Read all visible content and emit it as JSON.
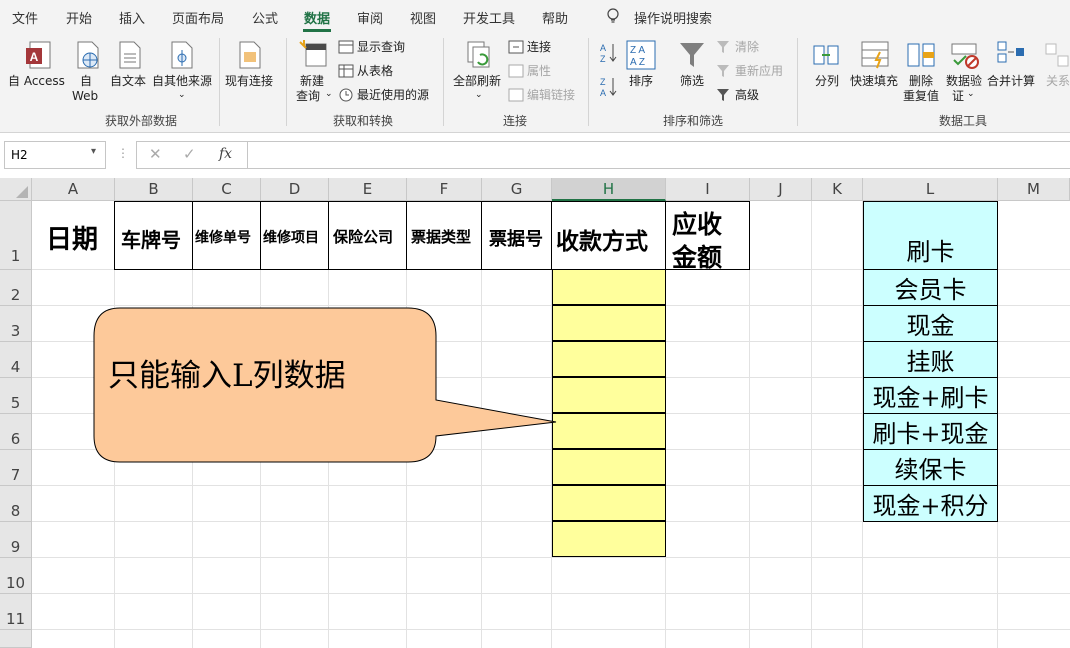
{
  "menu": {
    "items": [
      "文件",
      "开始",
      "插入",
      "页面布局",
      "公式",
      "数据",
      "审阅",
      "视图",
      "开发工具",
      "帮助"
    ],
    "active": "数据",
    "tell_me": "操作说明搜索"
  },
  "ribbon": {
    "get_external": {
      "label": "获取外部数据",
      "access": "自 Access",
      "web_1": "自",
      "web_2": "Web",
      "text": "自文本",
      "other": "自其他来源",
      "existing": "现有连接"
    },
    "get_transform": {
      "label": "获取和转换",
      "new_query_1": "新建",
      "new_query_2": "查询",
      "show_queries": "显示查询",
      "from_table": "从表格",
      "recent_sources": "最近使用的源"
    },
    "connections": {
      "label": "连接",
      "refresh_all": "全部刷新",
      "connections": "连接",
      "properties": "属性",
      "edit_links": "编辑链接"
    },
    "sort_filter": {
      "label": "排序和筛选",
      "sort": "排序",
      "filter": "筛选",
      "clear": "清除",
      "reapply": "重新应用",
      "advanced": "高级"
    },
    "data_tools": {
      "label": "数据工具",
      "text_to_columns": "分列",
      "flash_fill": "快速填充",
      "remove_dup_1": "删除",
      "remove_dup_2": "重复值",
      "validation_1": "数据验",
      "validation_2": "证",
      "consolidate": "合并计算",
      "relationships": "关系"
    }
  },
  "formula_bar": {
    "name_box": "H2",
    "formula": ""
  },
  "columns": [
    "A",
    "B",
    "C",
    "D",
    "E",
    "F",
    "G",
    "H",
    "I",
    "J",
    "K",
    "L",
    "M"
  ],
  "selected_column": "H",
  "rows": [
    "1",
    "2",
    "3",
    "4",
    "5",
    "6",
    "7",
    "8",
    "9",
    "10",
    "11"
  ],
  "header_row": {
    "a": "日期",
    "b": "车牌号",
    "c": "维修单号",
    "d": "维修项目",
    "e": "保险公司",
    "f": "票据类型",
    "g": "票据号",
    "h": "收款方式",
    "i_1": "应收",
    "i_2": "金额"
  },
  "list_l": [
    "刷卡",
    "会员卡",
    "现金",
    "挂账",
    "现金+刷卡",
    "刷卡+现金",
    "续保卡",
    "现金+积分"
  ],
  "callout": "只能输入L列数据",
  "colors": {
    "accent": "#217346",
    "yellow_cells": "#ffff9c",
    "cyan_cells": "#ccffff",
    "callout_fill": "#fdc99a"
  }
}
